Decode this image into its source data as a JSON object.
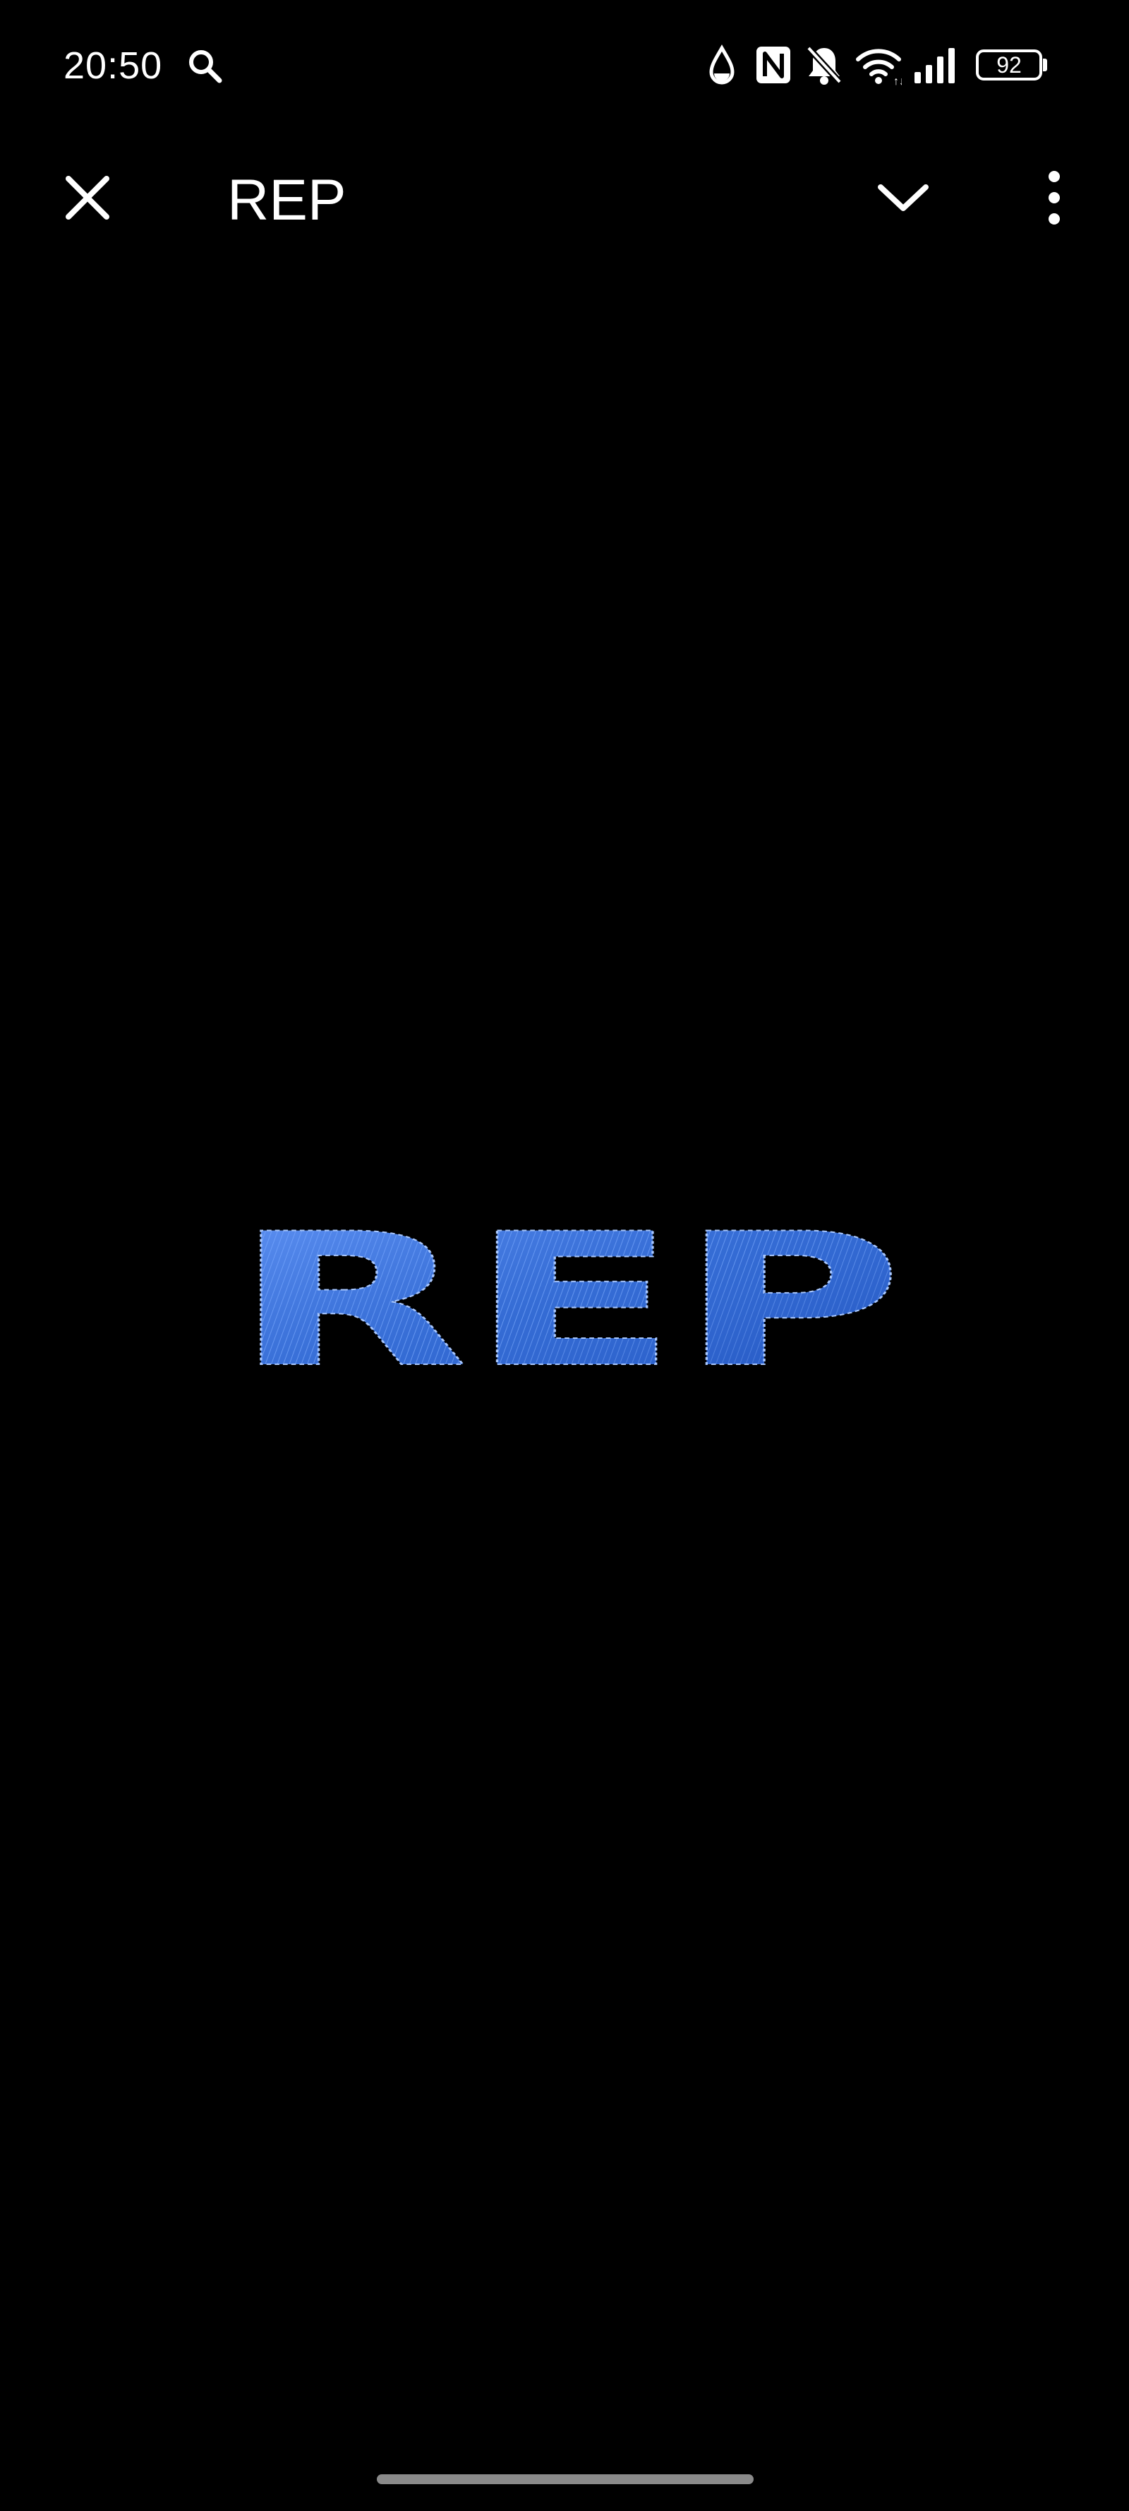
{
  "status_bar": {
    "time": "20:50",
    "battery_level": "92",
    "icons": [
      "search-icon",
      "water-drop-icon",
      "nfc-icon",
      "notifications-off-icon",
      "wifi-icon",
      "signal-icon",
      "battery-icon"
    ]
  },
  "app_bar": {
    "title": "REP",
    "icons": [
      "close-icon",
      "chevron-down-icon",
      "more-vert-icon"
    ]
  },
  "media": {
    "artwork_text": "REP",
    "artwork_color": "#3f7fe8",
    "background": "#000000"
  }
}
